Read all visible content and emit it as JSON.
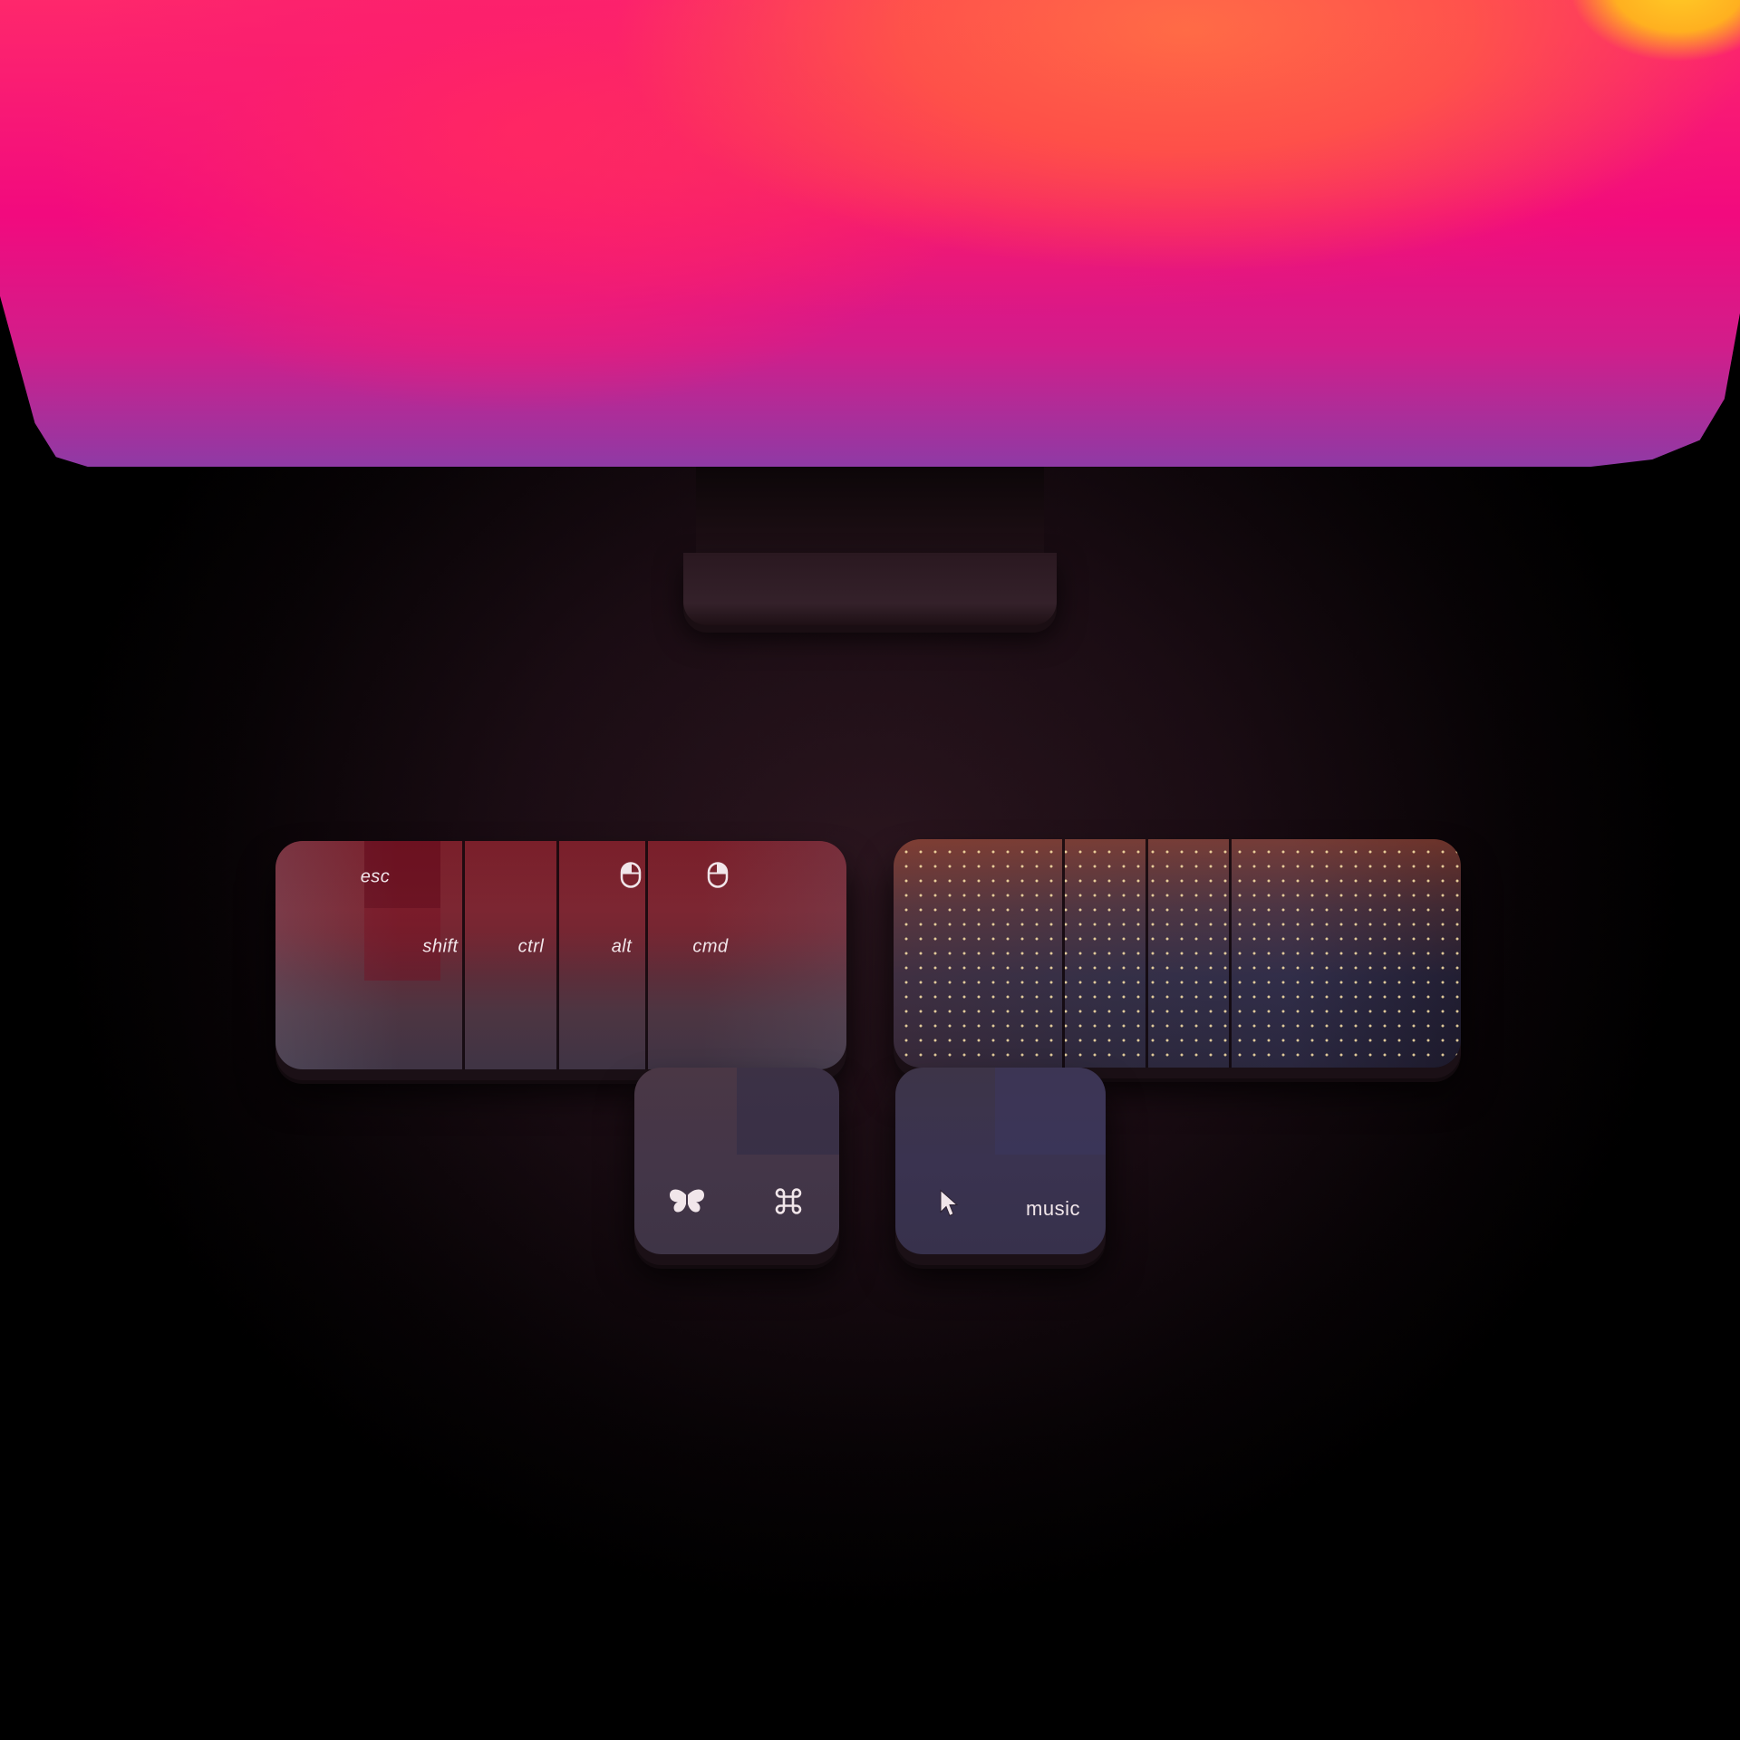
{
  "keys": {
    "esc": "esc",
    "shift": "shift",
    "ctrl": "ctrl",
    "alt": "alt",
    "cmd": "cmd",
    "music": "music"
  },
  "icons": {
    "mouse_left": "mouse-icon",
    "mouse_right": "mouse-icon",
    "butterfly": "butterfly-icon",
    "command": "command-icon",
    "pointer": "cursor-pointer-icon"
  },
  "colors": {
    "screen_pink": "#f20a7e",
    "screen_red": "#ff2a4f",
    "screen_orange": "#ff6d47",
    "screen_yellow": "#ffcc26",
    "background": "#120810"
  }
}
